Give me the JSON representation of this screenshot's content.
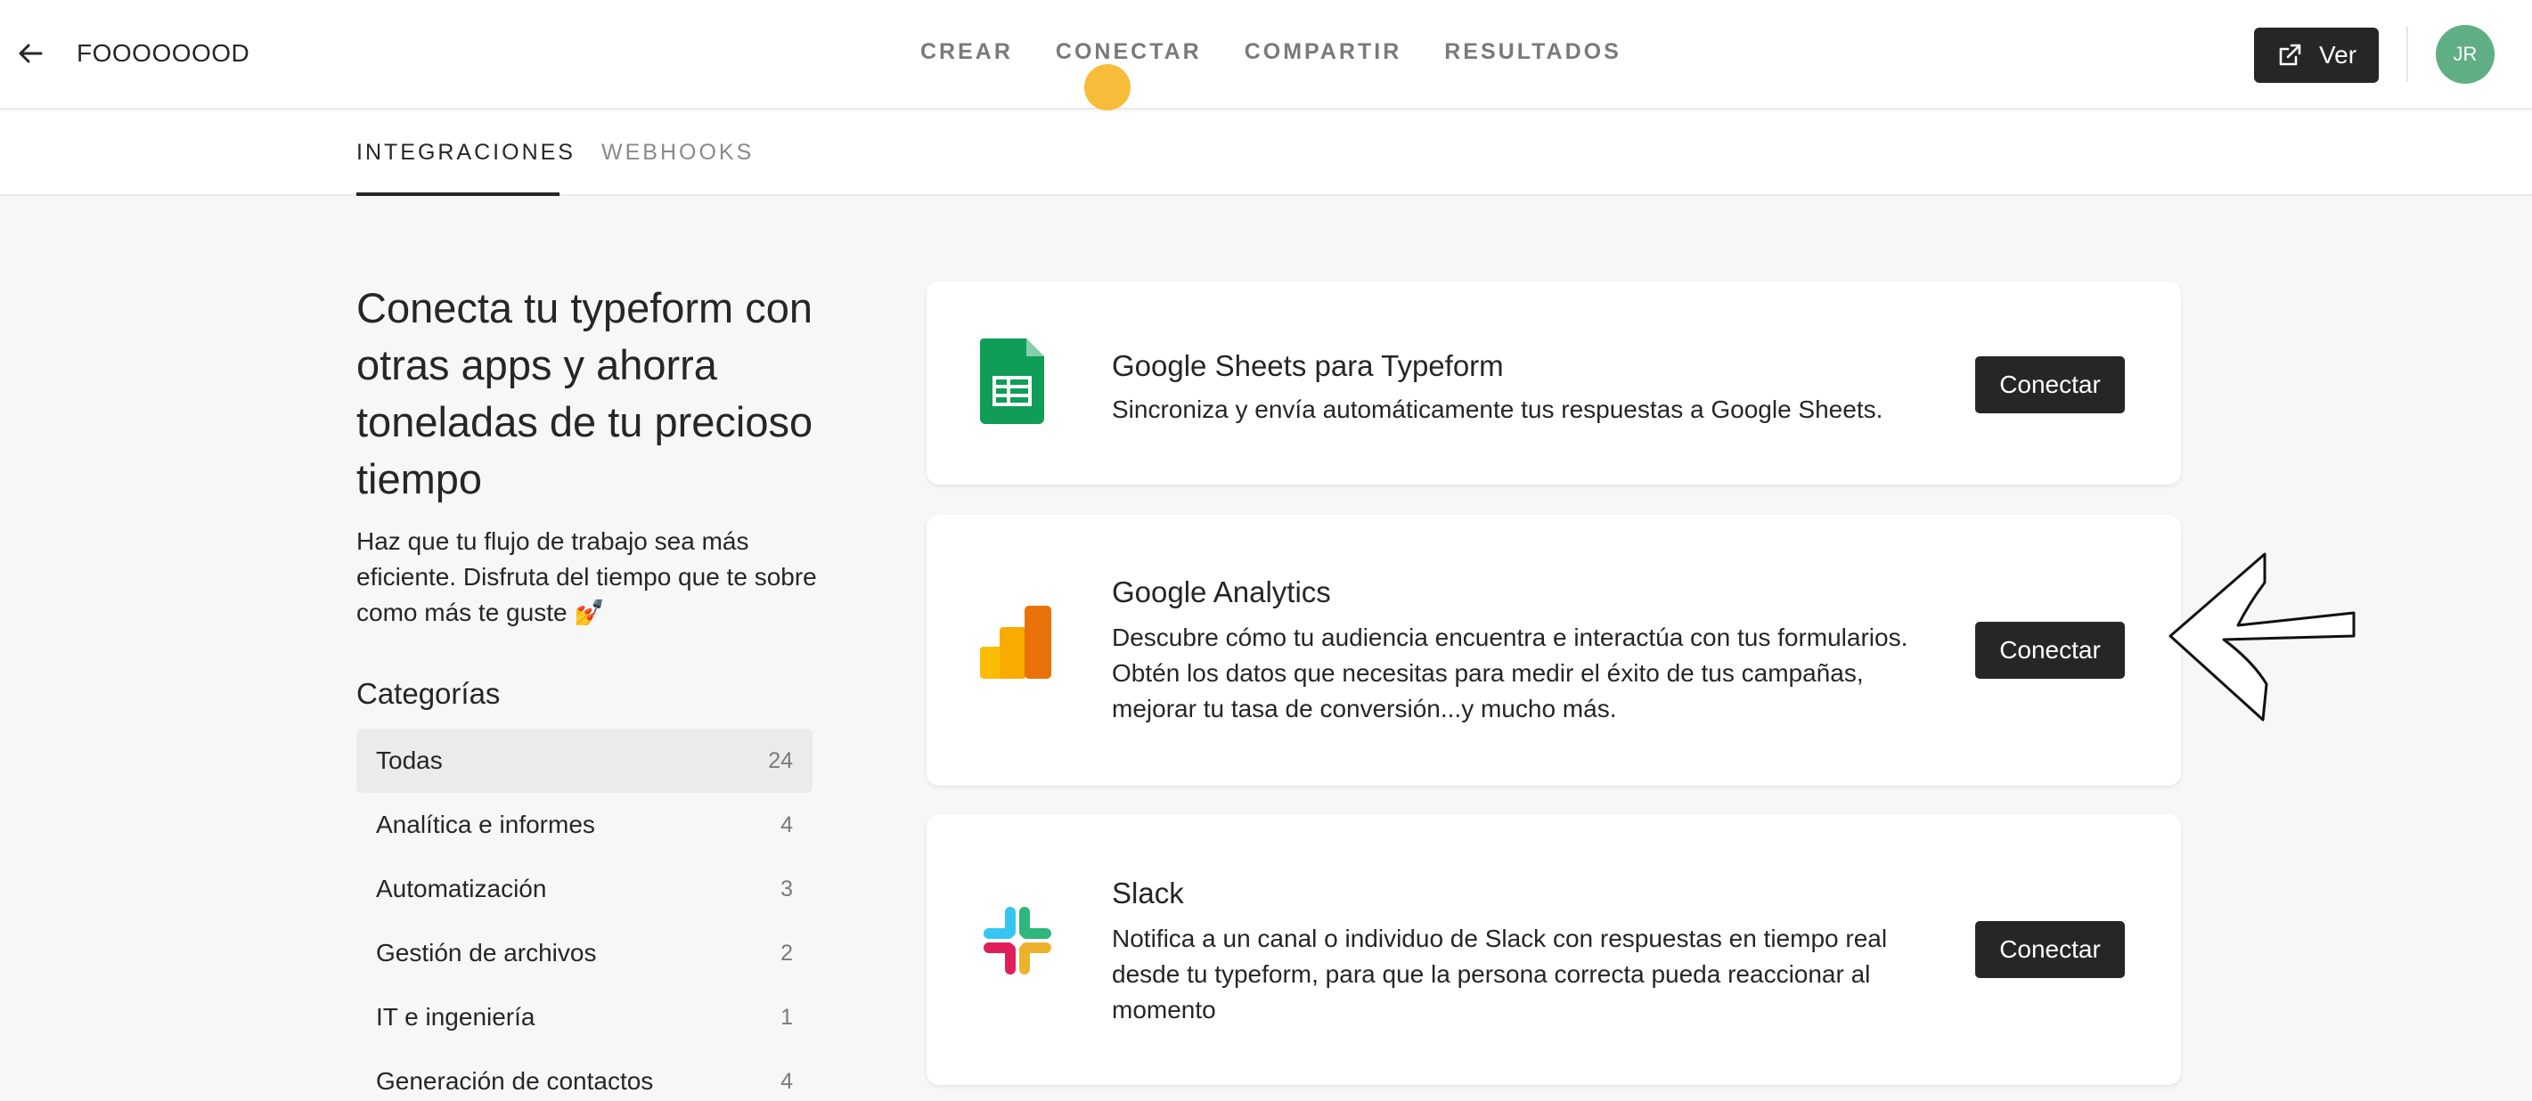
{
  "header": {
    "form_name": "FOOOOOOOD",
    "tabs": [
      "CREAR",
      "CONECTAR",
      "COMPARTIR",
      "RESULTADOS"
    ],
    "active_tab": "CONECTAR",
    "view_button": "Ver",
    "avatar_initials": "JR",
    "avatar_color": "#5fae84",
    "indicator_color": "#f7bd3a"
  },
  "subnav": {
    "tabs": [
      "INTEGRACIONES",
      "WEBHOOKS"
    ],
    "active": "INTEGRACIONES"
  },
  "intro": {
    "headline": "Conecta tu typeform con otras apps y ahorra toneladas de tu precioso tiempo",
    "subtext": "Haz que tu flujo de trabajo sea más eficiente. Disfruta del tiempo que te sobre como más te guste 💅"
  },
  "categories": {
    "title": "Categorías",
    "items": [
      {
        "label": "Todas",
        "count": "24"
      },
      {
        "label": "Analítica e informes",
        "count": "4"
      },
      {
        "label": "Automatización",
        "count": "3"
      },
      {
        "label": "Gestión de archivos",
        "count": "2"
      },
      {
        "label": "IT e ingeniería",
        "count": "1"
      },
      {
        "label": "Generación de contactos",
        "count": "4"
      }
    ]
  },
  "integrations": [
    {
      "title": "Google Sheets para Typeform",
      "description": "Sincroniza y envía automáticamente tus respuestas a Google Sheets.",
      "button": "Conectar",
      "icon": "google-sheets-icon"
    },
    {
      "title": "Google Analytics",
      "description": "Descubre cómo tu audiencia encuentra e interactúa con tus formularios. Obtén los datos que necesitas para medir el éxito de tus campañas, mejorar tu tasa de conversión...y mucho más.",
      "button": "Conectar",
      "icon": "google-analytics-icon"
    },
    {
      "title": "Slack",
      "description": "Notifica a un canal o individuo de Slack con respuestas en tiempo real desde tu typeform, para que la persona correcta pueda reaccionar al momento",
      "button": "Conectar",
      "icon": "slack-icon"
    }
  ]
}
